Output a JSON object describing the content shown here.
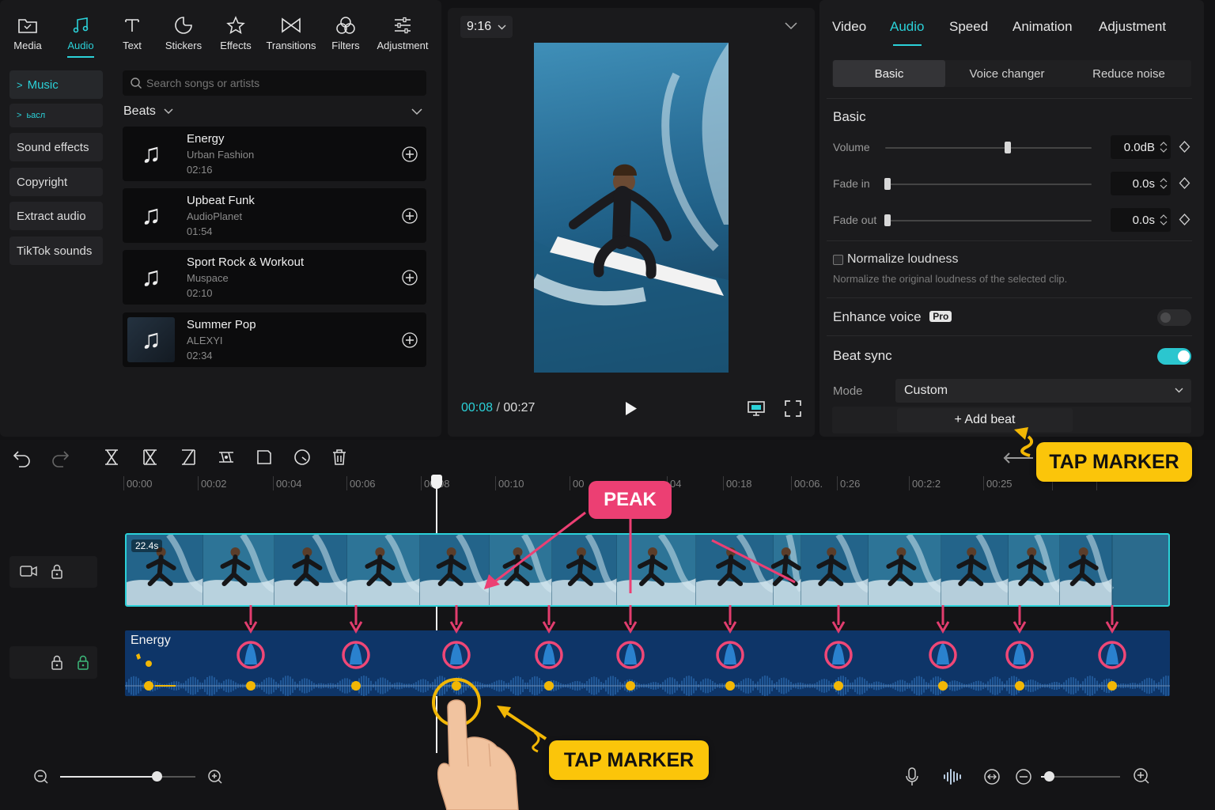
{
  "toolbar": {
    "items": [
      {
        "label": "Media",
        "icon": "folder-icon"
      },
      {
        "label": "Audio",
        "icon": "music-note-icon"
      },
      {
        "label": "Text",
        "icon": "text-icon"
      },
      {
        "label": "Stickers",
        "icon": "sticker-icon"
      },
      {
        "label": "Effects",
        "icon": "star-icon"
      },
      {
        "label": "Transitions",
        "icon": "bowtie-icon"
      },
      {
        "label": "Filters",
        "icon": "filter-icon"
      },
      {
        "label": "Adjustment",
        "icon": "sliders-icon"
      }
    ],
    "active": "Audio"
  },
  "sidebar": {
    "items": [
      {
        "label": "Music",
        "active": true
      },
      {
        "label": "ьасл",
        "active": false
      },
      {
        "label": "Sound effects"
      },
      {
        "label": "Copyright"
      },
      {
        "label": "Extract audio"
      },
      {
        "label": "TikTok sounds"
      }
    ]
  },
  "search": {
    "placeholder": "Search songs or artists"
  },
  "category": {
    "label": "Beats"
  },
  "songs": [
    {
      "title": "Energy",
      "artist": "Urban Fashion",
      "duration": "02:16"
    },
    {
      "title": "Upbeat Funk",
      "artist": "AudioPlanet",
      "duration": "01:54"
    },
    {
      "title": "Sport Rock & Workout",
      "artist": "Muspace",
      "duration": "02:10"
    },
    {
      "title": "Summer Pop",
      "artist": "ALEXYI",
      "duration": "02:34"
    }
  ],
  "preview": {
    "aspect": "9:16",
    "current_time": "00:08",
    "separator": "/",
    "total_time": "00:27"
  },
  "inspector": {
    "tabs": [
      "Video",
      "Audio",
      "Speed",
      "Animation",
      "Adjustment"
    ],
    "active_tab": "Audio",
    "subtabs": [
      "Basic",
      "Voice changer",
      "Reduce noise"
    ],
    "active_subtab": "Basic",
    "section_title": "Basic",
    "volume": {
      "label": "Volume",
      "value": "0.0dB",
      "level": 0.59
    },
    "fade_in": {
      "label": "Fade in",
      "value": "0.0s",
      "level": 0
    },
    "fade_out": {
      "label": "Fade out",
      "value": "0.0s",
      "level": 0
    },
    "normalize": {
      "label": "Normalize loudness",
      "desc": "Normalize the original loudness of the selected clip.",
      "checked": false
    },
    "enhance_voice": {
      "label": "Enhance voice",
      "badge": "Pro",
      "on": false
    },
    "beat_sync": {
      "label": "Beat sync",
      "on": true
    },
    "mode": {
      "label": "Mode",
      "value": "Custom"
    },
    "add_beat": "+ Add beat"
  },
  "timeline": {
    "ticks": [
      "00:00",
      "00:02",
      "00:04",
      "00:06",
      "00:08",
      "00:10",
      "00",
      "04",
      "00:18",
      "00:06.",
      "0:26",
      "00:2:2",
      "00:25",
      "",
      ""
    ],
    "video_clip_label": "22.4s",
    "audio_clip_label": "Energy"
  },
  "annotations": {
    "peak": "PEAK",
    "tap_marker_top": "TAP MARKER",
    "tap_marker_bottom": "TAP MARKER"
  },
  "colors": {
    "accent": "#2bd1d8",
    "audio_track": "#0f3a6e",
    "beat_marker": "#f2b705",
    "annotation_pink": "#ec3f73",
    "annotation_yellow": "#fbc50a"
  }
}
